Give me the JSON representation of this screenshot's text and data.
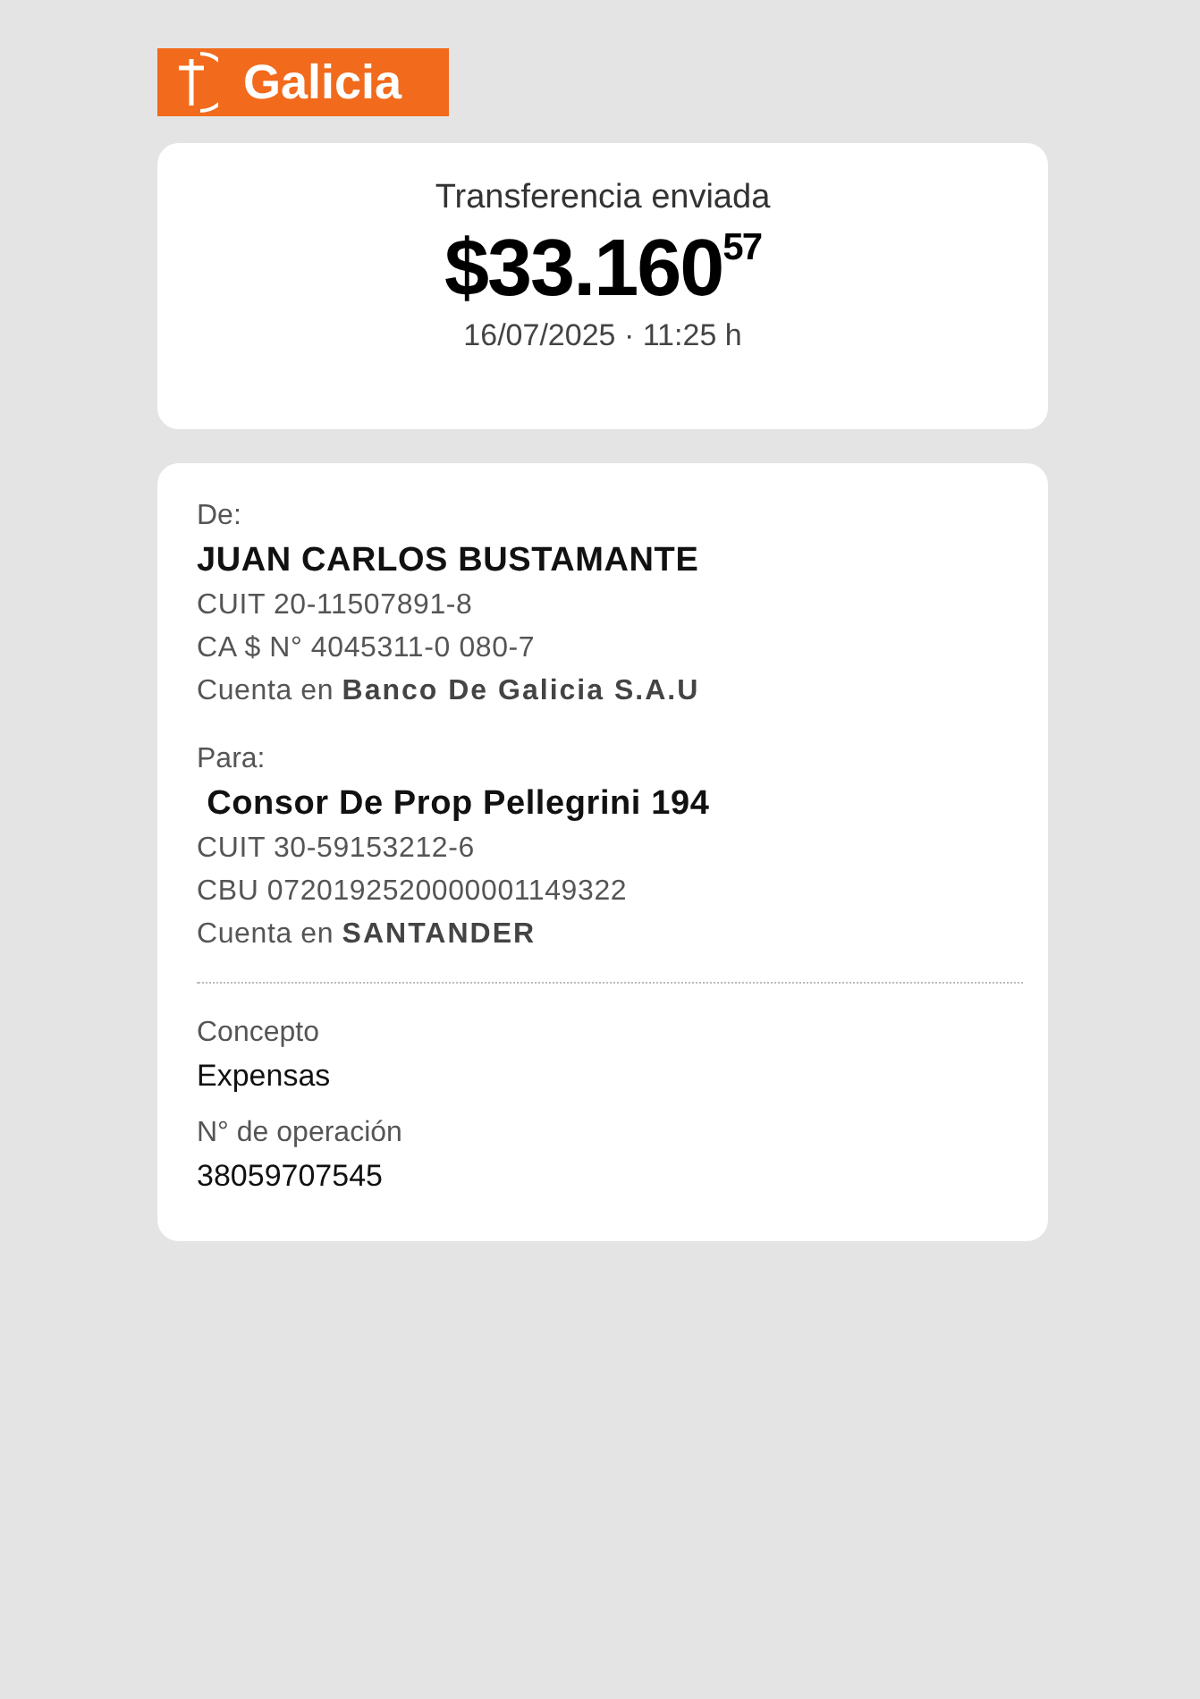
{
  "brand": {
    "name": "Galicia"
  },
  "summary": {
    "title": "Transferencia enviada",
    "amount": "$33.160",
    "cents": "57",
    "datetime": "16/07/2025 · 11:25 h"
  },
  "parties": [
    {
      "label": "De:",
      "name": "JUAN CARLOS BUSTAMANTE",
      "lines": [
        "CUIT 20-11507891-8",
        "CA $ N° 4045311-0 080-7",
        "Cuenta en **Banco De Galicia S.A.U**"
      ]
    },
    {
      "label": "Para:",
      "name": " Consor De Prop Pellegrini 194",
      "lines": [
        "CUIT 30-59153212-6",
        "CBU 0720192520000001149322",
        "Cuenta en **SANTANDER**"
      ]
    }
  ],
  "details": [
    {
      "label": "Concepto",
      "value": "Expensas"
    },
    {
      "label": "N° de operación",
      "value": "38059707545"
    }
  ]
}
